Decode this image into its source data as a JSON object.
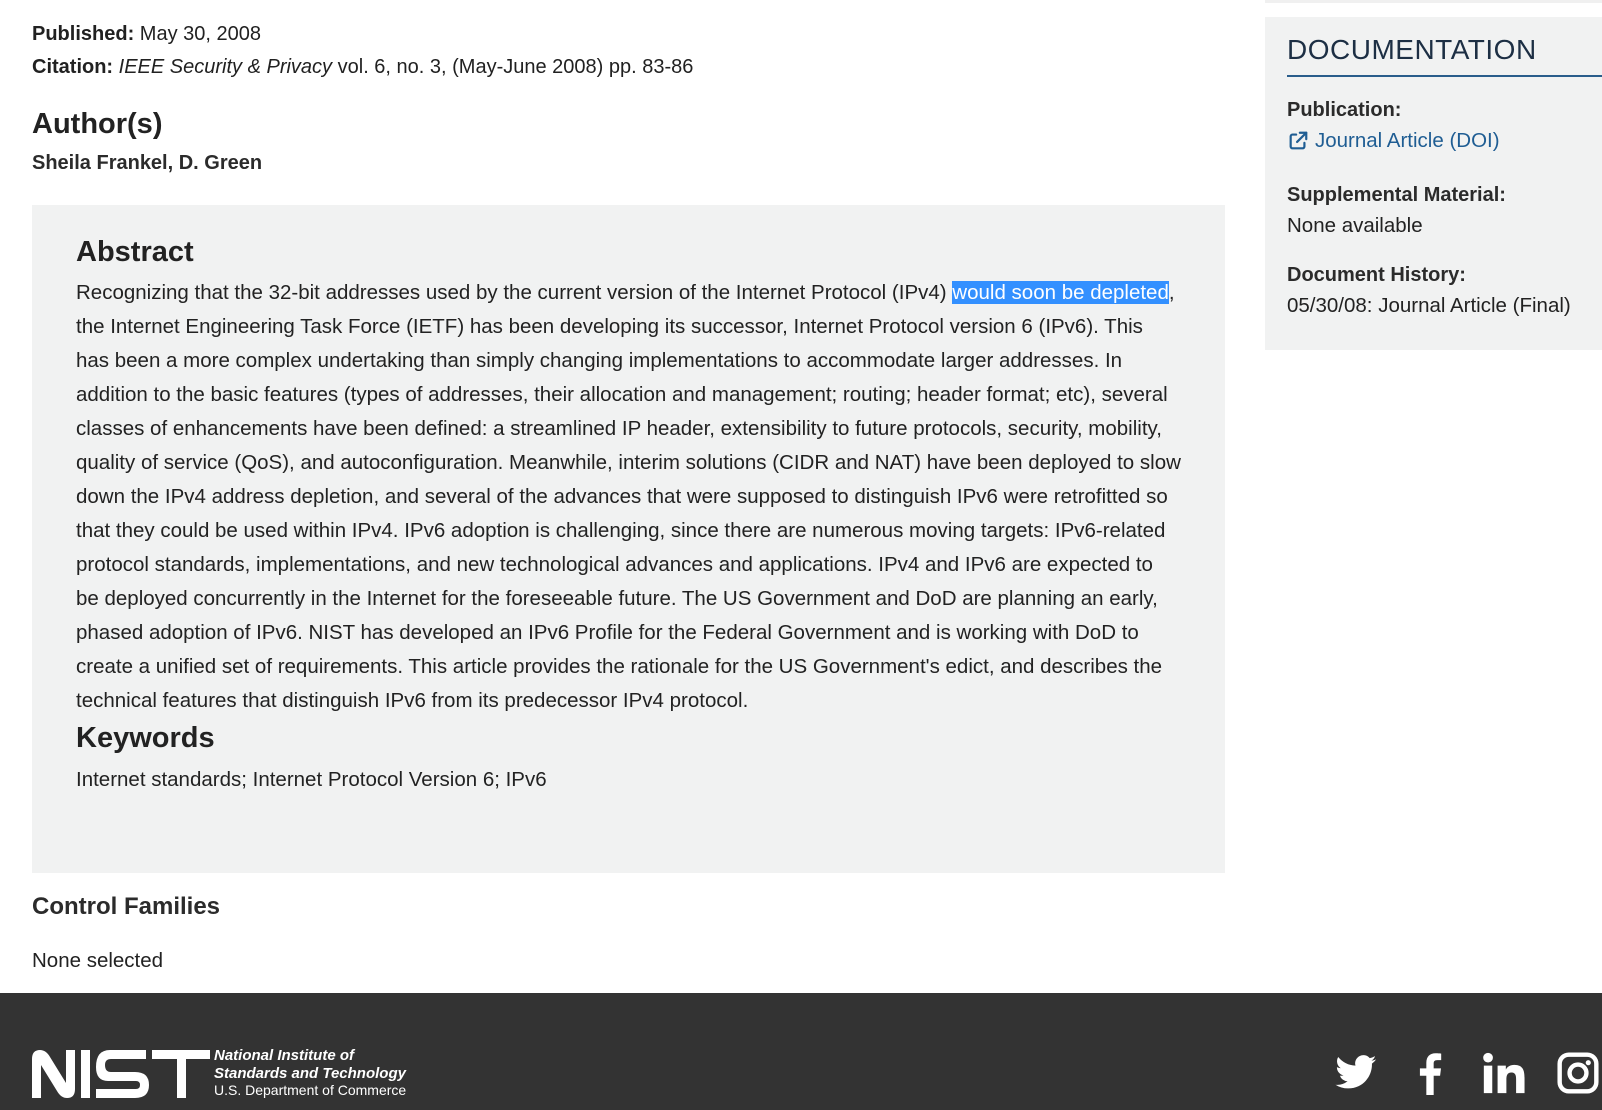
{
  "meta": {
    "published_label": "Published:",
    "published_value": "May 30, 2008",
    "citation_label": "Citation:",
    "citation_journal": "IEEE Security & Privacy",
    "citation_rest": "vol. 6, no. 3, (May-June 2008) pp. 83-86"
  },
  "authors": {
    "heading": "Author(s)",
    "names": "Sheila Frankel, D. Green"
  },
  "abstract": {
    "heading": "Abstract",
    "text_before": "Recognizing that the 32-bit addresses used by the current version of the Internet Protocol (IPv4) ",
    "text_selected": "would soon be depleted",
    "text_after": ", the Internet Engineering Task Force (IETF) has been developing its successor, Internet Protocol version 6 (IPv6). This has been a more complex undertaking than simply changing implementations to accommodate larger addresses. In addition to the basic features (types of addresses, their allocation and management; routing; header format; etc), several classes of enhancements have been defined: a streamlined IP header, extensibility to future protocols, security, mobility, quality of service (QoS), and autoconfiguration. Meanwhile, interim solutions (CIDR and NAT) have been deployed to slow down the IPv4 address depletion, and several of the advances that were supposed to distinguish IPv6 were retrofitted so that they could be used within IPv4. IPv6 adoption is challenging, since there are numerous moving targets: IPv6-related protocol standards, implementations, and new technological advances and applications. IPv4 and IPv6 are expected to be deployed concurrently in the Internet for the foreseeable future. The US Government and DoD are planning an early, phased adoption of IPv6. NIST has developed an IPv6 Profile for the Federal Government and is working with DoD to create a unified set of requirements. This article provides the rationale for the US Government's edict, and describes the technical features that distinguish IPv6 from its predecessor IPv4 protocol."
  },
  "keywords": {
    "heading": "Keywords",
    "text": "Internet standards; Internet Protocol Version 6; IPv6"
  },
  "control_families": {
    "heading": "Control Families",
    "value": "None selected"
  },
  "sidebar": {
    "heading": "DOCUMENTATION",
    "publication_label": "Publication:",
    "publication_link": "Journal Article (DOI)",
    "supplemental_label": "Supplemental Material:",
    "supplemental_value": "None available",
    "history_label": "Document History:",
    "history_value": "05/30/08: Journal Article (Final)"
  },
  "footer": {
    "logo_line1": "National Institute of",
    "logo_line2": "Standards and Technology",
    "logo_line3": "U.S. Department of Commerce",
    "social_icons": [
      "twitter-icon",
      "facebook-icon",
      "linkedin-icon",
      "instagram-icon"
    ]
  },
  "colors": {
    "link": "#1f5d93",
    "selection": "#3390ff",
    "panel_bg": "#f1f2f2",
    "footer_bg": "#333333"
  }
}
